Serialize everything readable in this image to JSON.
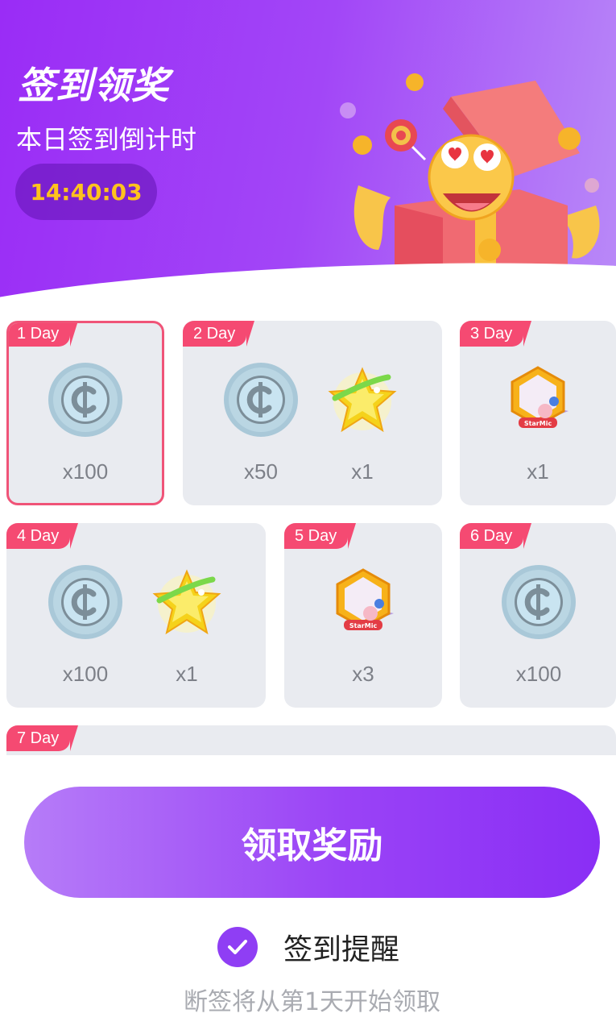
{
  "header": {
    "title": "签到领奖",
    "subtitle": "本日签到倒计时",
    "countdown": "14:40:03"
  },
  "days": [
    {
      "tag": "1 Day",
      "active": true,
      "rewards": [
        {
          "icon": "coin-icon",
          "qty": "x100"
        }
      ]
    },
    {
      "tag": "2 Day",
      "active": false,
      "rewards": [
        {
          "icon": "coin-icon",
          "qty": "x50"
        },
        {
          "icon": "star-badge-icon",
          "qty": "x1"
        }
      ]
    },
    {
      "tag": "3 Day",
      "active": false,
      "rewards": [
        {
          "icon": "hexagon-frame-icon",
          "qty": "x1"
        }
      ]
    },
    {
      "tag": "4 Day",
      "active": false,
      "rewards": [
        {
          "icon": "coin-icon",
          "qty": "x100"
        },
        {
          "icon": "star-badge-icon",
          "qty": "x1"
        }
      ]
    },
    {
      "tag": "5 Day",
      "active": false,
      "rewards": [
        {
          "icon": "hexagon-frame-icon",
          "qty": "x3"
        }
      ]
    },
    {
      "tag": "6 Day",
      "active": false,
      "rewards": [
        {
          "icon": "coin-icon",
          "qty": "x100"
        }
      ]
    },
    {
      "tag": "7 Day",
      "active": false,
      "rewards": []
    }
  ],
  "claim_button": {
    "label": "领取奖励"
  },
  "reminder": {
    "label": "签到提醒",
    "checked": true
  },
  "note": "断签将从第1天开始领取",
  "colors": {
    "accent": "#9a43f6",
    "day_tag": "#f54a72",
    "timer_text": "#ffc21e",
    "card_bg": "#e9ebf0"
  }
}
